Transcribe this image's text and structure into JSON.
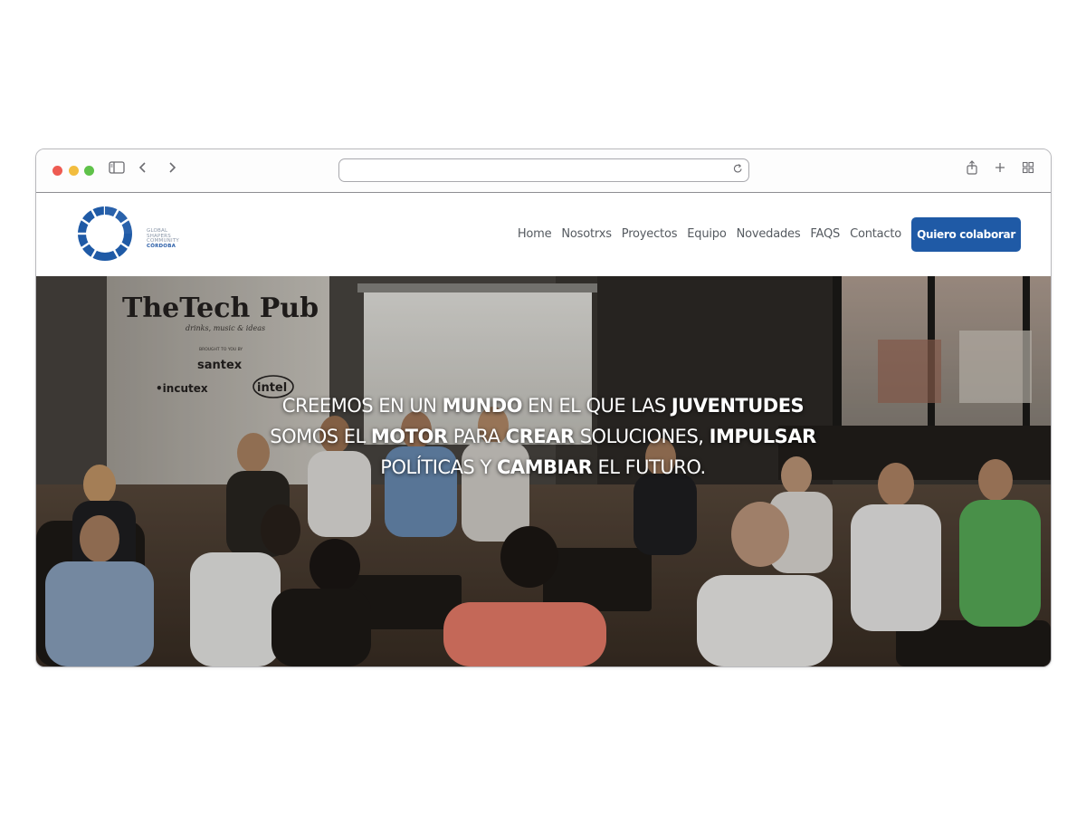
{
  "browser": {
    "traffic_lights": [
      "#ee5b52",
      "#f2bd3f",
      "#5fc24a"
    ],
    "icons": [
      "sidebar-icon",
      "back-icon",
      "forward-icon",
      "reload-icon",
      "share-icon",
      "new-tab-icon",
      "tabs-overview-icon"
    ],
    "url": ""
  },
  "site": {
    "logo": {
      "lines": [
        "GLOBAL",
        "SHAPERS",
        "COMMUNITY",
        "CÓRDOBA"
      ]
    },
    "nav": {
      "items": [
        "Home",
        "Nosotrxs",
        "Proyectos",
        "Equipo",
        "Novedades",
        "FAQS",
        "Contacto"
      ],
      "cta": "Quiero colaborar"
    },
    "accent": "#1f5aa6",
    "hero": {
      "photo_signage": {
        "title": "TheTech Pub",
        "tagline": "drinks, music & ideas",
        "brought": "BROUGHT TO YOU BY",
        "sponsors": [
          "santex",
          "•incutex",
          "intel"
        ]
      },
      "headline": [
        {
          "t": "CREEMOS ",
          "b": false
        },
        {
          "t": "EN UN ",
          "b": false
        },
        {
          "t": "MUNDO",
          "b": true
        },
        {
          "t": " EN EL QUE LAS ",
          "b": false
        },
        {
          "t": "JUVENTUDES",
          "b": true
        },
        {
          "t": " SOMOS EL ",
          "b": false
        },
        {
          "t": "MOTOR",
          "b": true
        },
        {
          "t": " PARA ",
          "b": false
        },
        {
          "t": "CREAR",
          "b": true
        },
        {
          "t": " SOLUCIONES, ",
          "b": false
        },
        {
          "t": "IMPULSAR",
          "b": true
        },
        {
          "t": " POLÍTICAS Y ",
          "b": false
        },
        {
          "t": "CAMBIAR",
          "b": true
        },
        {
          "t": " EL FUTURO.",
          "b": false
        }
      ]
    }
  }
}
